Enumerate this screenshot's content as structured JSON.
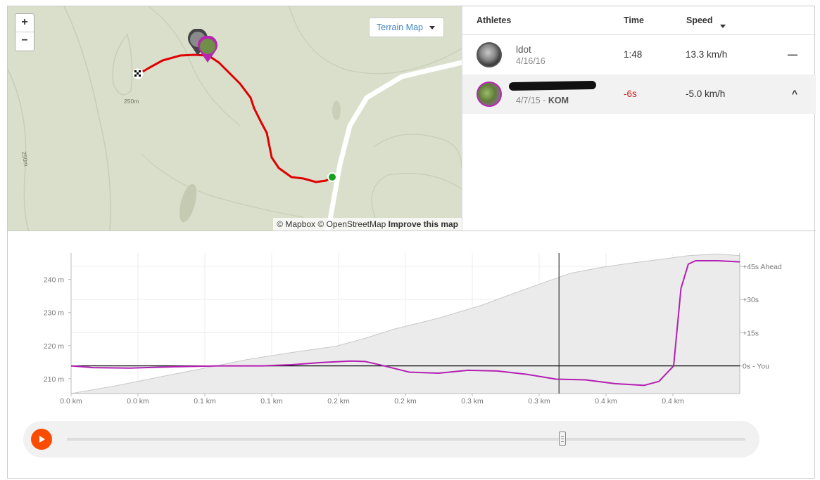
{
  "map": {
    "zoom_in": "+",
    "zoom_out": "−",
    "terrain_label": "Terrain Map",
    "contour_labels": [
      "250m",
      "250m"
    ],
    "attribution": {
      "mapbox": "© Mapbox",
      "osm": "© OpenStreetMap",
      "improve": "Improve this map"
    },
    "colors": {
      "route": "#e00000",
      "start": "#18a018",
      "road": "#ffffff",
      "terrain": "#d9dfcb"
    }
  },
  "table": {
    "headers": {
      "athletes": "Athletes",
      "time": "Time",
      "speed": "Speed"
    },
    "rows": [
      {
        "name": "ldot",
        "date": "4/16/16",
        "kom": "",
        "time": "1:48",
        "speed": "13.3 km/h",
        "control": "—"
      },
      {
        "name": "",
        "date": "4/7/15 - ",
        "kom": "KOM",
        "time": "-6s",
        "speed": "-5.0 km/h",
        "control": "^"
      }
    ]
  },
  "chart_data": {
    "type": "area",
    "x_ticks": [
      "0.0 km",
      "0.0 km",
      "0.1 km",
      "0.1 km",
      "0.2 km",
      "0.2 km",
      "0.3 km",
      "0.3 km",
      "0.4 km",
      "0.4 km"
    ],
    "y_left_ticks": [
      "240 m",
      "230 m",
      "220 m",
      "210 m"
    ],
    "y_left_values": [
      240,
      230,
      220,
      210
    ],
    "y_left_range": [
      205.5,
      248
    ],
    "y_right_ticks": [
      "+45s Ahead",
      "+30s",
      "+15s",
      "0s - You"
    ],
    "y_right_values": [
      45,
      30,
      15,
      0
    ],
    "y_right_range": [
      -12.5,
      51
    ],
    "x_range": [
      0,
      0.455
    ],
    "series": [
      {
        "kind": "elevation",
        "x": [
          0,
          0.03,
          0.06,
          0.09,
          0.12,
          0.15,
          0.18,
          0.2,
          0.22,
          0.25,
          0.28,
          0.3,
          0.32,
          0.34,
          0.36,
          0.38,
          0.4,
          0.42,
          0.44,
          0.455
        ],
        "values": [
          205.5,
          207.8,
          210.5,
          213.1,
          215.8,
          217.9,
          219.8,
          222.2,
          225,
          228.3,
          232.3,
          235.6,
          238.8,
          241.9,
          243.6,
          244.9,
          246.0,
          247.2,
          247.7,
          247.2
        ]
      },
      {
        "kind": "time-gap",
        "x": [
          0,
          0.015,
          0.04,
          0.07,
          0.1,
          0.13,
          0.15,
          0.17,
          0.19,
          0.2,
          0.21,
          0.23,
          0.25,
          0.27,
          0.29,
          0.31,
          0.33,
          0.35,
          0.37,
          0.39,
          0.4,
          0.41,
          0.415,
          0.42,
          0.425,
          0.44,
          0.455
        ],
        "values": [
          0,
          -0.8,
          -1,
          -0.4,
          0,
          0,
          0.5,
          1.5,
          2.2,
          2,
          0.5,
          -2.8,
          -3.3,
          -2,
          -2.3,
          -3.8,
          -6,
          -6.3,
          -8,
          -8.8,
          -7,
          0,
          35,
          46,
          47.5,
          47.5,
          47
        ]
      }
    ],
    "cursor_x": 0.332,
    "colors": {
      "elevation_fill": "#ebebeb",
      "elevation_line": "#c8c8c8",
      "gap_line": "#b31fb3",
      "zero_line": "#000000"
    }
  },
  "player": {
    "progress": 0.73
  }
}
